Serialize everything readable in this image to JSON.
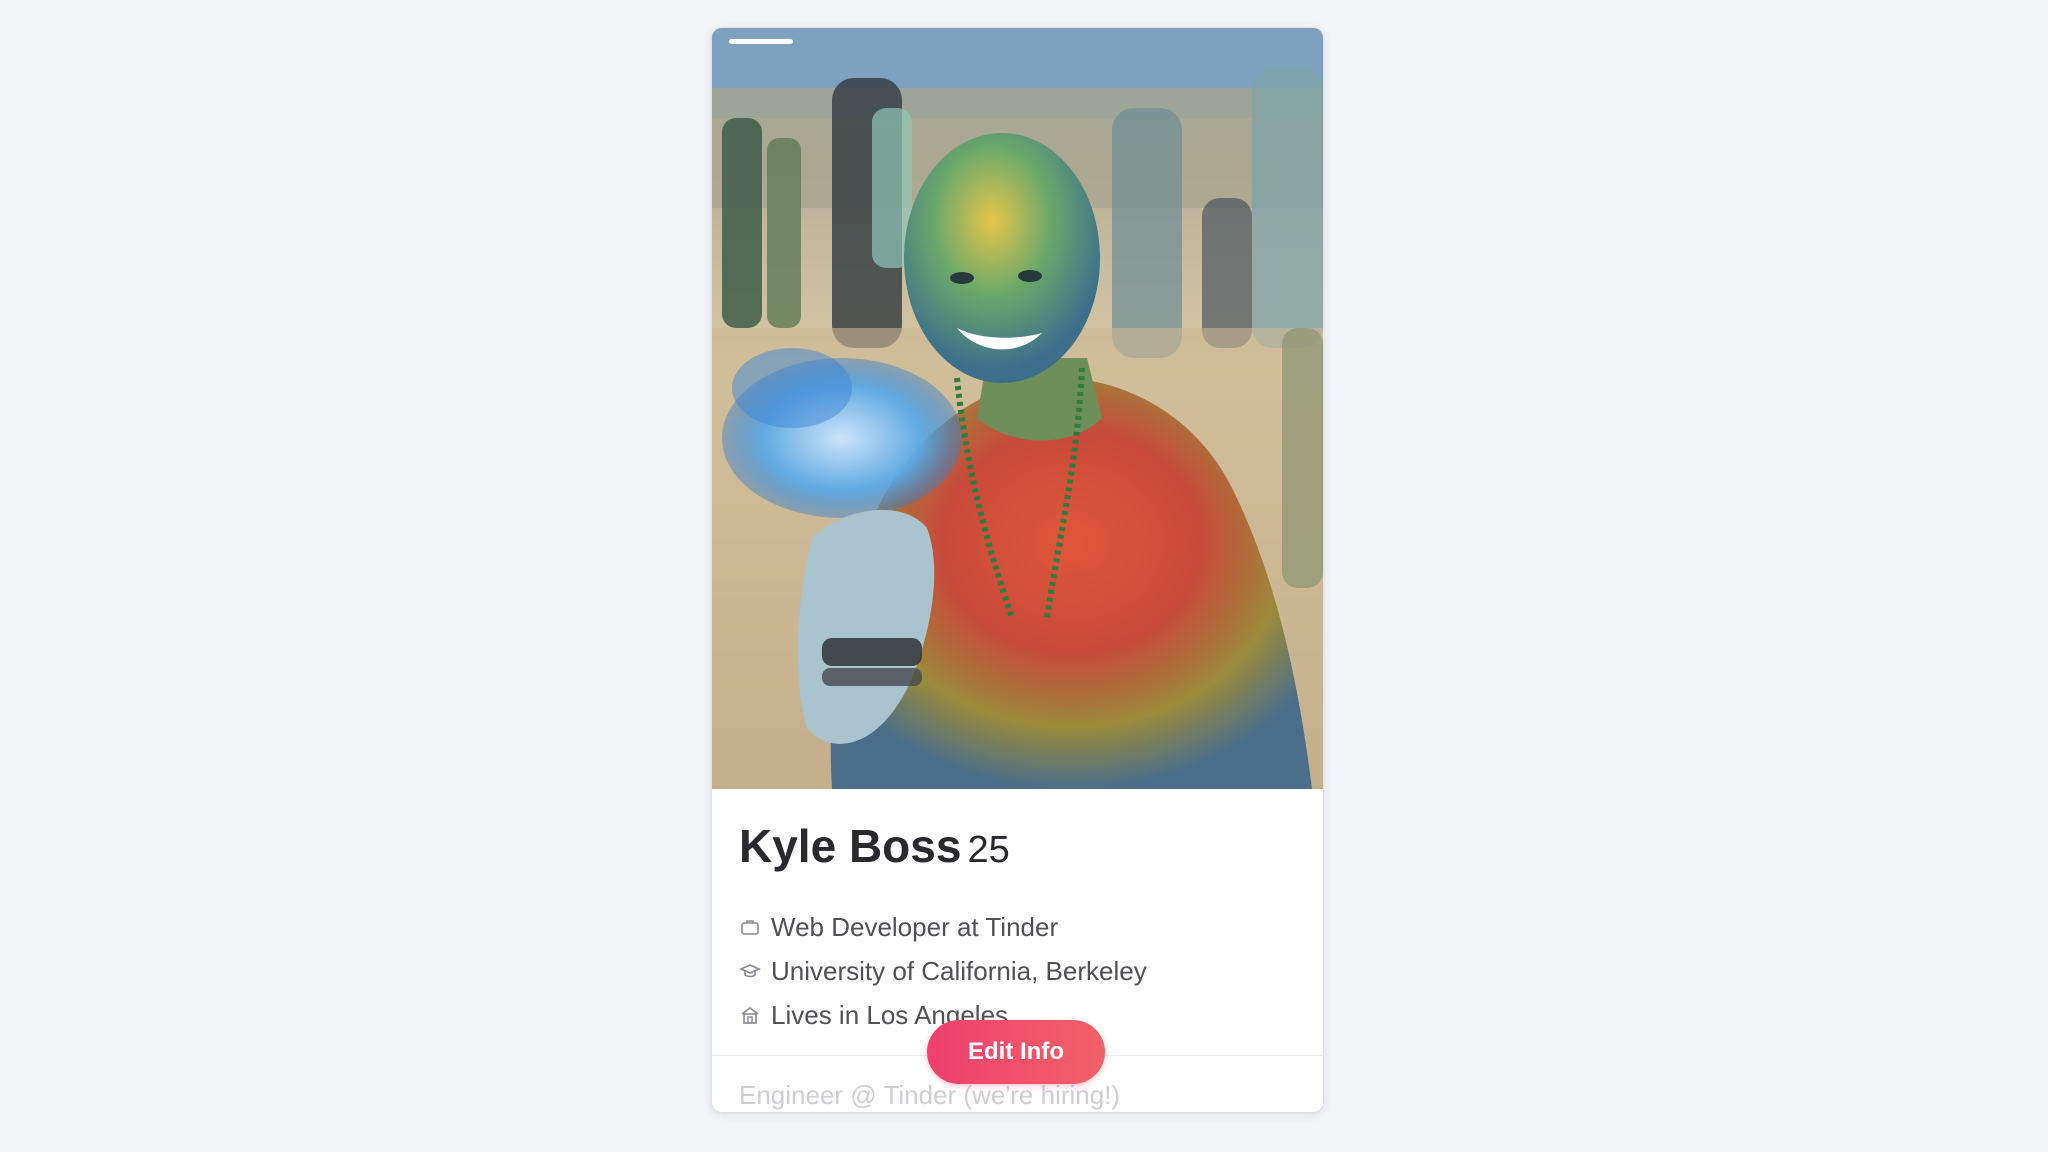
{
  "profile": {
    "name": "Kyle Boss",
    "age": "25",
    "job": "Web Developer at Tinder",
    "school": "University of California, Berkeley",
    "location": "Lives in Los Angeles",
    "bio": "Engineer @ Tinder (we're hiring!)"
  },
  "photo": {
    "current_index": 1,
    "description_icon": "photo"
  },
  "actions": {
    "edit_label": "Edit Info"
  },
  "colors": {
    "background": "#f4f5f9",
    "accent_start": "#ef3f6e",
    "accent_end": "#f26268",
    "name_text": "#2a2a2e",
    "detail_text": "#505055",
    "bio_text": "#cfcfd3"
  },
  "icons": {
    "job": "briefcase-icon",
    "school": "graduation-cap-icon",
    "location": "house-icon"
  }
}
